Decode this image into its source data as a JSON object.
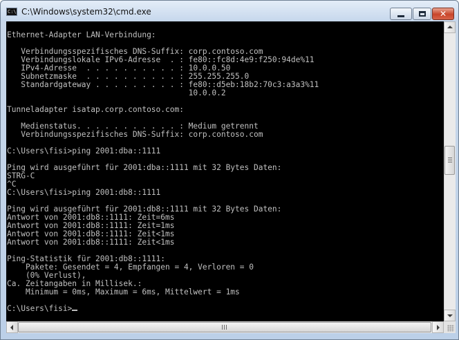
{
  "window": {
    "title": "C:\\Windows\\system32\\cmd.exe",
    "icon": "console-icon",
    "icon_label": "C:\\"
  },
  "controls": {
    "minimize_icon": "minimize-icon",
    "maximize_icon": "maximize-icon",
    "close_icon": "close-icon",
    "close_glyph": "✕"
  },
  "console": {
    "background": "#000000",
    "foreground": "#c0c0c0",
    "lines": [
      "",
      "Ethernet-Adapter LAN-Verbindung:",
      "",
      "   Verbindungsspezifisches DNS-Suffix: corp.contoso.com",
      "   Verbindungslokale IPv6-Adresse  . : fe80::fc8d:4e9:f250:94de%11",
      "   IPv4-Adresse  . . . . . . . . . . : 10.0.0.50",
      "   Subnetzmaske  . . . . . . . . . . : 255.255.255.0",
      "   Standardgateway . . . . . . . . . : fe80::d5eb:18b2:70c3:a3a3%11",
      "                                       10.0.0.2",
      "",
      "Tunneladapter isatap.corp.contoso.com:",
      "",
      "   Medienstatus. . . . . . . . . . . : Medium getrennt",
      "   Verbindungsspezifisches DNS-Suffix: corp.contoso.com",
      "",
      "C:\\Users\\fisi>ping 2001:dba::1111",
      "",
      "Ping wird ausgeführt für 2001:dba::1111 mit 32 Bytes Daten:",
      "STRG-C",
      "^C",
      "C:\\Users\\fisi>ping 2001:db8::1111",
      "",
      "Ping wird ausgeführt für 2001:db8::1111 mit 32 Bytes Daten:",
      "Antwort von 2001:db8::1111: Zeit=6ms",
      "Antwort von 2001:db8::1111: Zeit=1ms",
      "Antwort von 2001:db8::1111: Zeit<1ms",
      "Antwort von 2001:db8::1111: Zeit<1ms",
      "",
      "Ping-Statistik für 2001:db8::1111:",
      "    Pakete: Gesendet = 4, Empfangen = 4, Verloren = 0",
      "    (0% Verlust),",
      "Ca. Zeitangaben in Millisek.:",
      "    Minimum = 0ms, Maximum = 6ms, Mittelwert = 1ms",
      "",
      "C:\\Users\\fisi>"
    ]
  },
  "scrollbars": {
    "vertical": {
      "up_icon": "arrow-up-icon",
      "down_icon": "arrow-down-icon"
    },
    "horizontal": {
      "left_icon": "arrow-left-icon",
      "right_icon": "arrow-right-icon"
    }
  }
}
